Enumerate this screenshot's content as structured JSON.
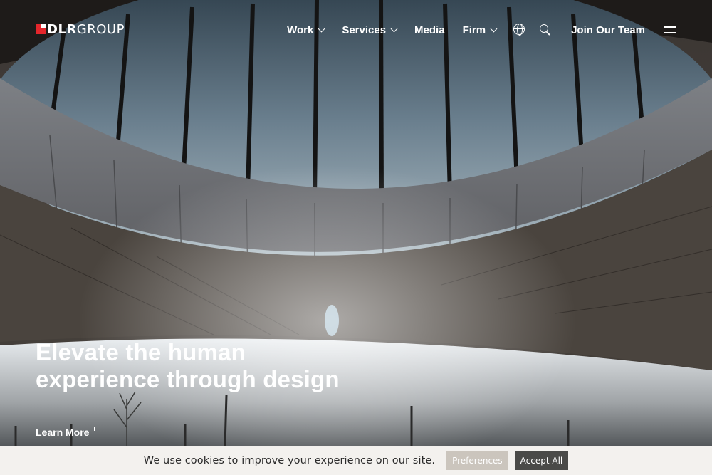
{
  "brand": {
    "mark_color": "#e4262b",
    "name_bold": "DLR",
    "name_light": "GROUP"
  },
  "nav": {
    "items": [
      {
        "label": "Work",
        "has_dropdown": true
      },
      {
        "label": "Services",
        "has_dropdown": true
      },
      {
        "label": "Media",
        "has_dropdown": false
      },
      {
        "label": "Firm",
        "has_dropdown": true
      }
    ],
    "icons": [
      "globe-icon",
      "search-icon"
    ],
    "join_label": "Join Our Team",
    "menu_icon": "hamburger-menu-icon"
  },
  "hero": {
    "headline_line1": "Elevate the human",
    "headline_line2": "experience through design",
    "cta_label": "Learn More"
  },
  "cookie_bar": {
    "message": "We use cookies to improve your experience on our site.",
    "preferences_label": "Preferences",
    "accept_label": "Accept All"
  }
}
